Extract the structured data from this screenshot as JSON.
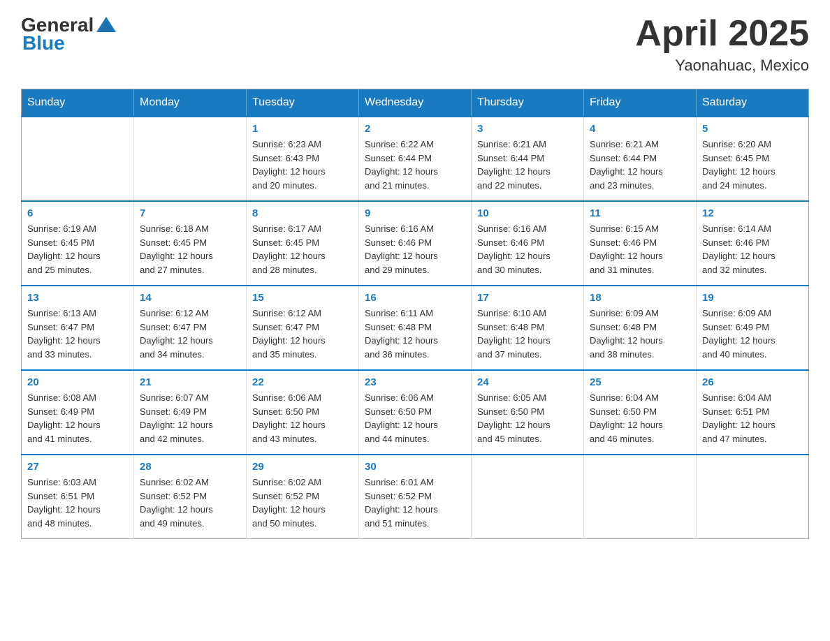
{
  "header": {
    "logo": {
      "general": "General",
      "blue": "Blue",
      "tagline": ""
    },
    "title": "April 2025",
    "subtitle": "Yaonahuac, Mexico"
  },
  "calendar": {
    "days_of_week": [
      "Sunday",
      "Monday",
      "Tuesday",
      "Wednesday",
      "Thursday",
      "Friday",
      "Saturday"
    ],
    "weeks": [
      [
        {
          "day": "",
          "info": ""
        },
        {
          "day": "",
          "info": ""
        },
        {
          "day": "1",
          "info": "Sunrise: 6:23 AM\nSunset: 6:43 PM\nDaylight: 12 hours\nand 20 minutes."
        },
        {
          "day": "2",
          "info": "Sunrise: 6:22 AM\nSunset: 6:44 PM\nDaylight: 12 hours\nand 21 minutes."
        },
        {
          "day": "3",
          "info": "Sunrise: 6:21 AM\nSunset: 6:44 PM\nDaylight: 12 hours\nand 22 minutes."
        },
        {
          "day": "4",
          "info": "Sunrise: 6:21 AM\nSunset: 6:44 PM\nDaylight: 12 hours\nand 23 minutes."
        },
        {
          "day": "5",
          "info": "Sunrise: 6:20 AM\nSunset: 6:45 PM\nDaylight: 12 hours\nand 24 minutes."
        }
      ],
      [
        {
          "day": "6",
          "info": "Sunrise: 6:19 AM\nSunset: 6:45 PM\nDaylight: 12 hours\nand 25 minutes."
        },
        {
          "day": "7",
          "info": "Sunrise: 6:18 AM\nSunset: 6:45 PM\nDaylight: 12 hours\nand 27 minutes."
        },
        {
          "day": "8",
          "info": "Sunrise: 6:17 AM\nSunset: 6:45 PM\nDaylight: 12 hours\nand 28 minutes."
        },
        {
          "day": "9",
          "info": "Sunrise: 6:16 AM\nSunset: 6:46 PM\nDaylight: 12 hours\nand 29 minutes."
        },
        {
          "day": "10",
          "info": "Sunrise: 6:16 AM\nSunset: 6:46 PM\nDaylight: 12 hours\nand 30 minutes."
        },
        {
          "day": "11",
          "info": "Sunrise: 6:15 AM\nSunset: 6:46 PM\nDaylight: 12 hours\nand 31 minutes."
        },
        {
          "day": "12",
          "info": "Sunrise: 6:14 AM\nSunset: 6:46 PM\nDaylight: 12 hours\nand 32 minutes."
        }
      ],
      [
        {
          "day": "13",
          "info": "Sunrise: 6:13 AM\nSunset: 6:47 PM\nDaylight: 12 hours\nand 33 minutes."
        },
        {
          "day": "14",
          "info": "Sunrise: 6:12 AM\nSunset: 6:47 PM\nDaylight: 12 hours\nand 34 minutes."
        },
        {
          "day": "15",
          "info": "Sunrise: 6:12 AM\nSunset: 6:47 PM\nDaylight: 12 hours\nand 35 minutes."
        },
        {
          "day": "16",
          "info": "Sunrise: 6:11 AM\nSunset: 6:48 PM\nDaylight: 12 hours\nand 36 minutes."
        },
        {
          "day": "17",
          "info": "Sunrise: 6:10 AM\nSunset: 6:48 PM\nDaylight: 12 hours\nand 37 minutes."
        },
        {
          "day": "18",
          "info": "Sunrise: 6:09 AM\nSunset: 6:48 PM\nDaylight: 12 hours\nand 38 minutes."
        },
        {
          "day": "19",
          "info": "Sunrise: 6:09 AM\nSunset: 6:49 PM\nDaylight: 12 hours\nand 40 minutes."
        }
      ],
      [
        {
          "day": "20",
          "info": "Sunrise: 6:08 AM\nSunset: 6:49 PM\nDaylight: 12 hours\nand 41 minutes."
        },
        {
          "day": "21",
          "info": "Sunrise: 6:07 AM\nSunset: 6:49 PM\nDaylight: 12 hours\nand 42 minutes."
        },
        {
          "day": "22",
          "info": "Sunrise: 6:06 AM\nSunset: 6:50 PM\nDaylight: 12 hours\nand 43 minutes."
        },
        {
          "day": "23",
          "info": "Sunrise: 6:06 AM\nSunset: 6:50 PM\nDaylight: 12 hours\nand 44 minutes."
        },
        {
          "day": "24",
          "info": "Sunrise: 6:05 AM\nSunset: 6:50 PM\nDaylight: 12 hours\nand 45 minutes."
        },
        {
          "day": "25",
          "info": "Sunrise: 6:04 AM\nSunset: 6:50 PM\nDaylight: 12 hours\nand 46 minutes."
        },
        {
          "day": "26",
          "info": "Sunrise: 6:04 AM\nSunset: 6:51 PM\nDaylight: 12 hours\nand 47 minutes."
        }
      ],
      [
        {
          "day": "27",
          "info": "Sunrise: 6:03 AM\nSunset: 6:51 PM\nDaylight: 12 hours\nand 48 minutes."
        },
        {
          "day": "28",
          "info": "Sunrise: 6:02 AM\nSunset: 6:52 PM\nDaylight: 12 hours\nand 49 minutes."
        },
        {
          "day": "29",
          "info": "Sunrise: 6:02 AM\nSunset: 6:52 PM\nDaylight: 12 hours\nand 50 minutes."
        },
        {
          "day": "30",
          "info": "Sunrise: 6:01 AM\nSunset: 6:52 PM\nDaylight: 12 hours\nand 51 minutes."
        },
        {
          "day": "",
          "info": ""
        },
        {
          "day": "",
          "info": ""
        },
        {
          "day": "",
          "info": ""
        }
      ]
    ]
  }
}
